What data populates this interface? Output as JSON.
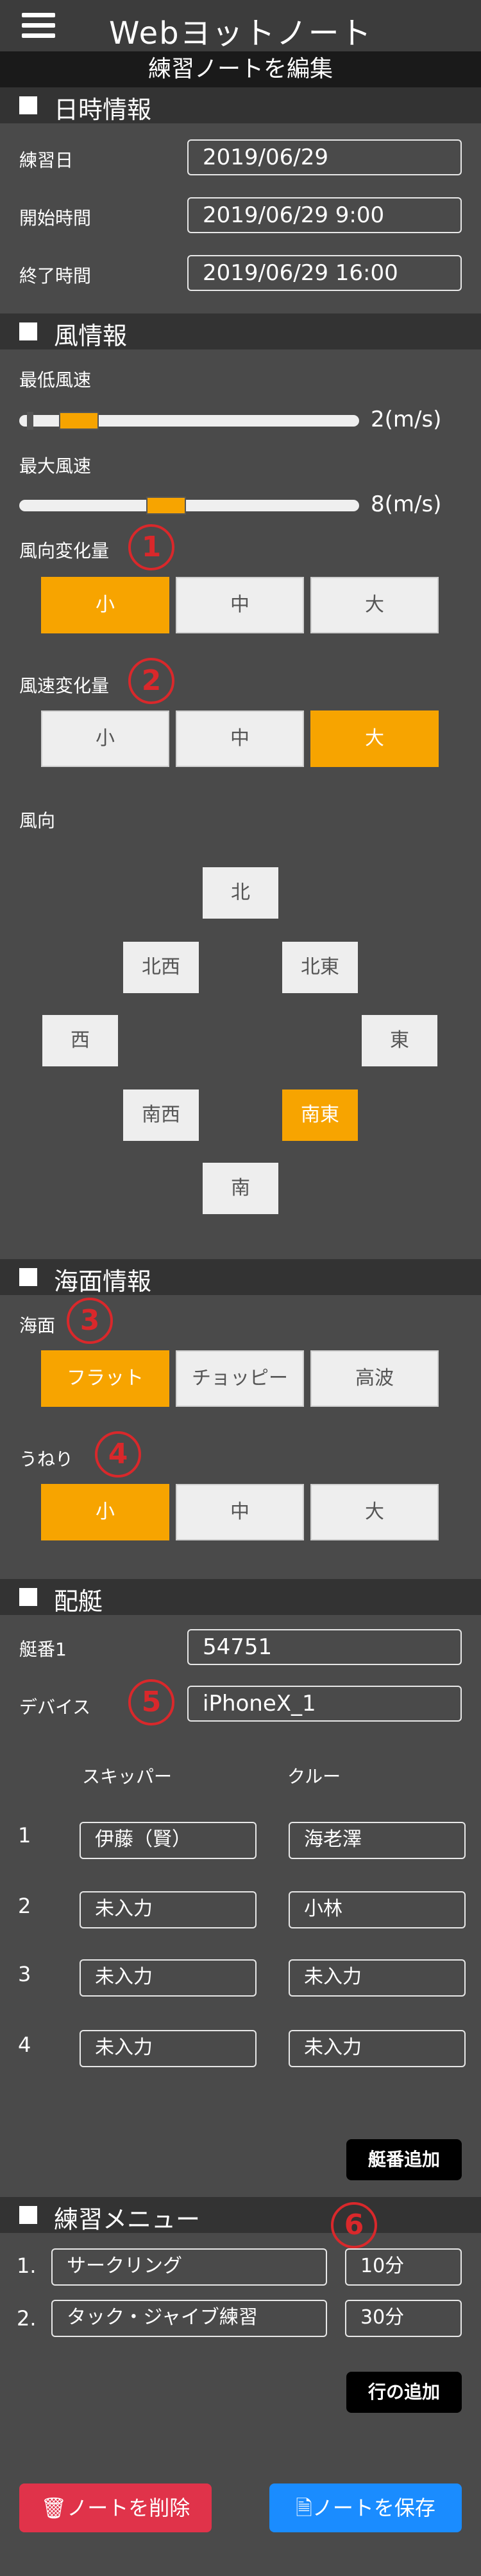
{
  "header": {
    "title": "Webヨットノート",
    "subtitle": "練習ノートを編集"
  },
  "datetime": {
    "section_title": "日時情報",
    "date_label": "練習日",
    "date_value": "2019/06/29",
    "start_label": "開始時間",
    "start_value": "2019/06/29 9:00",
    "end_label": "終了時間",
    "end_value": "2019/06/29 16:00"
  },
  "wind": {
    "section_title": "風情報",
    "min_label": "最低風速",
    "min_value": "2(m/s)",
    "min_level": 2,
    "max_label": "最大風速",
    "max_value": "8(m/s)",
    "max_level": 8,
    "dir_change_label": "風向変化量",
    "dir_change_badge": "1",
    "dir_change_options": [
      "小",
      "中",
      "大"
    ],
    "dir_change_selected": "小",
    "speed_change_label": "風速変化量",
    "speed_change_badge": "2",
    "speed_change_options": [
      "小",
      "中",
      "大"
    ],
    "speed_change_selected": "大",
    "direction_label": "風向",
    "directions": {
      "n": "北",
      "nw": "北西",
      "ne": "北東",
      "w": "西",
      "e": "東",
      "sw": "南西",
      "se": "南東",
      "s": "南"
    },
    "direction_selected": "南東"
  },
  "sea": {
    "section_title": "海面情報",
    "surface_label": "海面",
    "surface_badge": "3",
    "surface_options": [
      "フラット",
      "チョッピー",
      "高波"
    ],
    "surface_selected": "フラット",
    "swell_label": "うねり",
    "swell_badge": "4",
    "swell_options": [
      "小",
      "中",
      "大"
    ],
    "swell_selected": "小"
  },
  "crew": {
    "section_title": "配艇",
    "hull_label": "艇番1",
    "hull_value": "54751",
    "device_label": "デバイス",
    "device_badge": "5",
    "device_value": "iPhoneX_1",
    "skipper_header": "スキッパー",
    "crew_header": "クルー",
    "rows": [
      {
        "no": "1",
        "skipper": "伊藤（賢）",
        "crew": "海老澤"
      },
      {
        "no": "2",
        "skipper": "未入力",
        "crew": "小林"
      },
      {
        "no": "3",
        "skipper": "未入力",
        "crew": "未入力"
      },
      {
        "no": "4",
        "skipper": "未入力",
        "crew": "未入力"
      }
    ],
    "add_boat_label": "艇番追加"
  },
  "menu": {
    "section_title": "練習メニュー",
    "badge": "6",
    "items": [
      {
        "no": "1.",
        "name": "サークリング",
        "duration": "10分"
      },
      {
        "no": "2.",
        "name": "タック・ジャイブ練習",
        "duration": "30分"
      }
    ],
    "add_row_label": "行の追加"
  },
  "footer": {
    "delete_label": "🗑ノートを削除",
    "save_label": "🗎ノートを保存",
    "delete_color": "#e0334a",
    "save_color": "#1a8cff"
  },
  "colors": {
    "accent": "#f7a400",
    "badge": "#d9282b"
  }
}
